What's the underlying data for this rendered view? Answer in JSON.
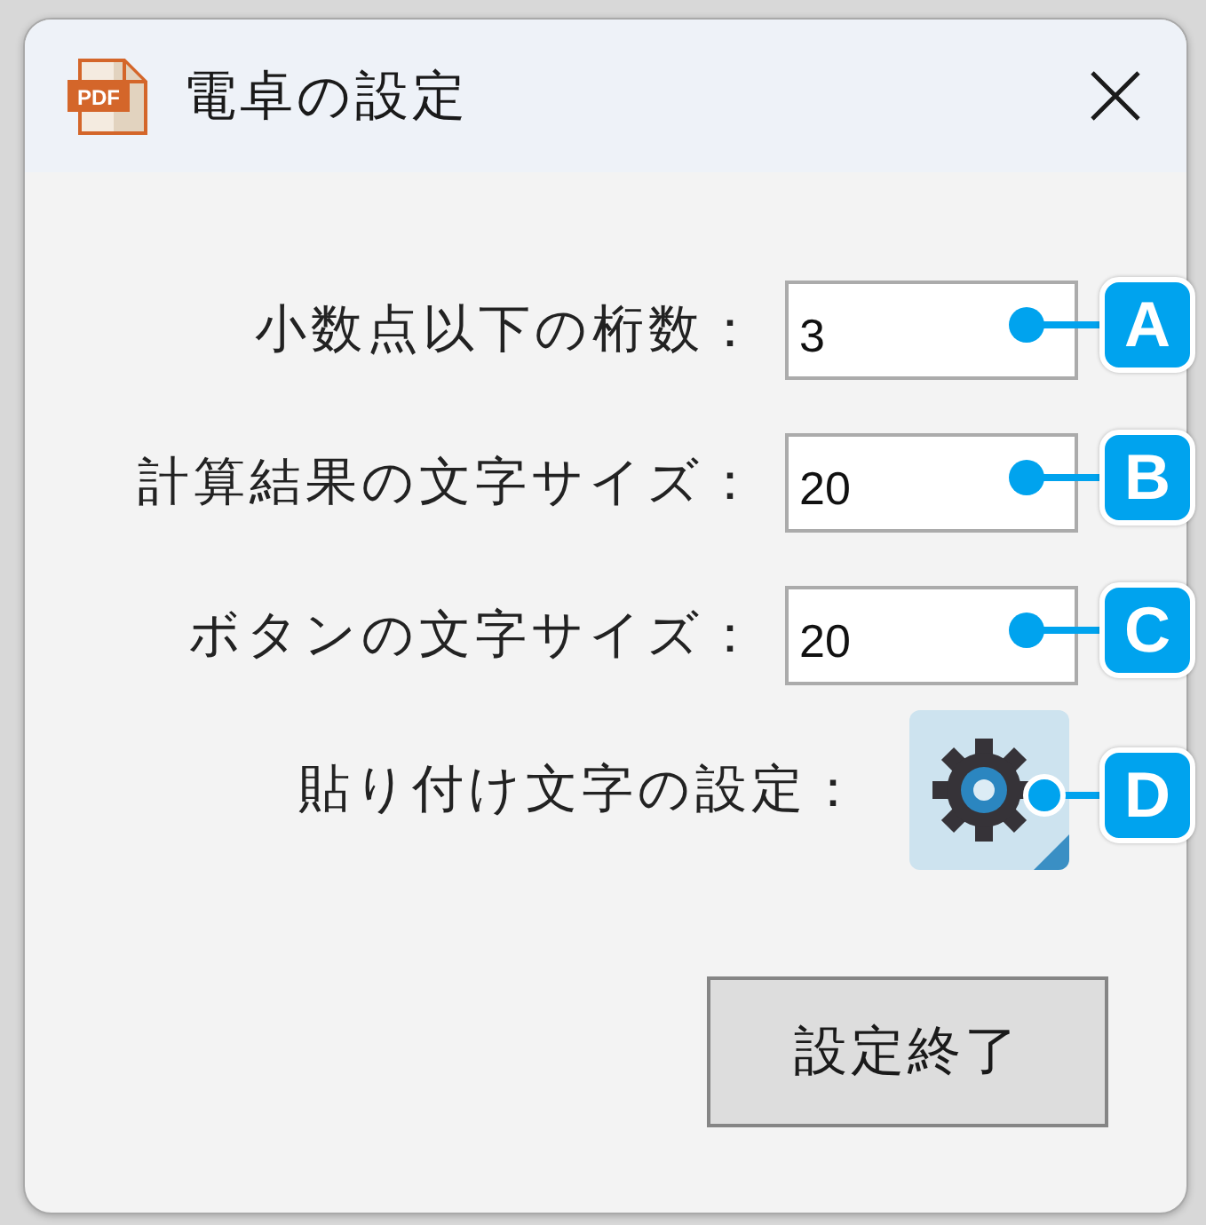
{
  "window": {
    "title": "電卓の設定",
    "icon_text": "PDF"
  },
  "settings": [
    {
      "kind": "field",
      "label": "小数点以下の桁数：",
      "value": "3",
      "marker": "A"
    },
    {
      "kind": "field",
      "label": "計算結果の文字サイズ：",
      "value": "20",
      "marker": "B"
    },
    {
      "kind": "field",
      "label": "ボタンの文字サイズ：",
      "value": "20",
      "marker": "C"
    },
    {
      "kind": "gear_button",
      "label": "貼り付け文字の設定：",
      "marker": "D"
    }
  ],
  "buttons": [
    "設定終了"
  ]
}
